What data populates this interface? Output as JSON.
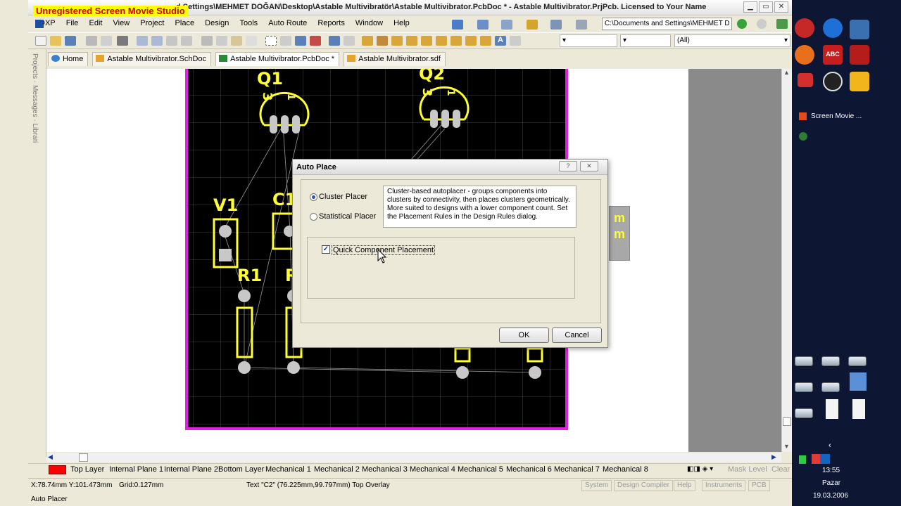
{
  "watermark": "Unregistered Screen Movie Studio",
  "window": {
    "title": "d Settings\\MEHMET DOĞAN\\Desktop\\Astable Multivibratör\\Astable Multivibrator.PcbDoc * - Astable Multivibrator.PrjPcb. Licensed to Your Name"
  },
  "menu": {
    "items": [
      "DXP",
      "File",
      "Edit",
      "View",
      "Project",
      "Place",
      "Design",
      "Tools",
      "Auto Route",
      "Reports",
      "Window",
      "Help"
    ],
    "path": "C:\\Documents and Settings\\MEHMET D"
  },
  "toolbar": {
    "layer_filter": "(All)"
  },
  "tabs": [
    {
      "label": "Home"
    },
    {
      "label": "Astable Multivibrator.SchDoc"
    },
    {
      "label": "Astable Multivibrator.PcbDoc *"
    },
    {
      "label": "Astable Multivibrator.sdf"
    }
  ],
  "left_panel": {
    "label": "Projects · Messages · Librari"
  },
  "pcb": {
    "designators": [
      "Q1",
      "Q2",
      "V1",
      "C1",
      "R1",
      "R"
    ],
    "pin_labels": [
      "3",
      "1",
      "3",
      "1"
    ],
    "side_labels": [
      "m",
      "m"
    ]
  },
  "dialog": {
    "title": "Auto Place",
    "help_label": "?",
    "close_label": "✕",
    "cluster_label": "Cluster Placer",
    "statistical_label": "Statistical Placer",
    "selected_placer": "Cluster Placer",
    "description": "Cluster-based autoplacer - groups components into clusters by connectivity, then places  clusters geometrically. More suited to designs with a lower component count. Set the Placement Rules in the Design Rules dialog.",
    "quick_label": "Quick Component Placement",
    "quick_checked": true,
    "ok_label": "OK",
    "cancel_label": "Cancel"
  },
  "layers": [
    "Top Layer",
    "Internal Plane 1",
    "Internal Plane 2",
    "Bottom Layer",
    "Mechanical 1",
    "Mechanical 2",
    "Mechanical 3",
    "Mechanical 4",
    "Mechanical 5",
    "Mechanical 6",
    "Mechanical 7",
    "Mechanical 8"
  ],
  "layerbar_right": {
    "mask": "Mask Level",
    "clear": "Clear"
  },
  "status": {
    "coords": "X:78.74mm Y:101.473mm",
    "grid": "Grid:0.127mm",
    "selection": "Text \"C2\" (76.225mm,99.797mm)  Top Overlay",
    "mode": "Auto Placer",
    "buttons": [
      "System",
      "Design Compiler",
      "Help",
      "Instruments",
      "PCB"
    ]
  },
  "taskbar": {
    "task": "Screen Movie ...",
    "time": "13:55",
    "day": "Pazar",
    "date": "19.03.2006",
    "abc_label": "ABC"
  },
  "colors": {
    "pcb_bg": "#000000",
    "board_outline": "#e020e0",
    "silk": "#ffff33",
    "pad": "#c8c8c8",
    "dialog_bg": "#ece9d8"
  }
}
